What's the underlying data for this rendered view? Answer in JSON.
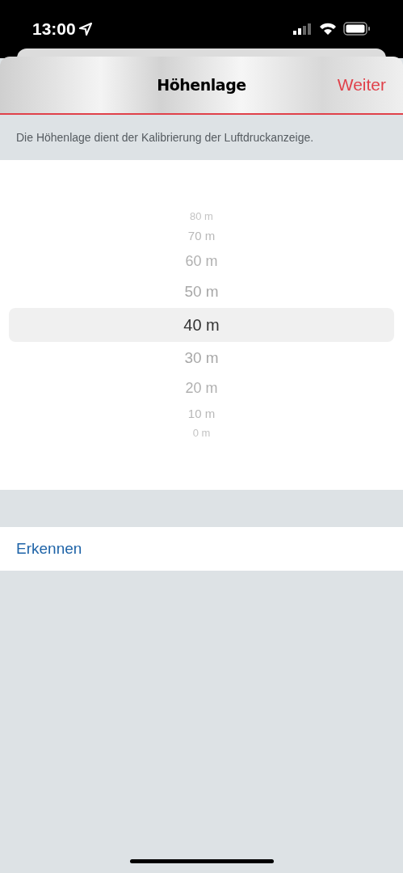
{
  "status_bar": {
    "time": "13:00"
  },
  "nav": {
    "title": "Höhenlage",
    "action": "Weiter"
  },
  "description": "Die Höhenlage dient der Kalibrierung der Luftdruckanzeige.",
  "picker": {
    "items": [
      {
        "label": "80 m",
        "selected": false
      },
      {
        "label": "70 m",
        "selected": false
      },
      {
        "label": "60 m",
        "selected": false
      },
      {
        "label": "50 m",
        "selected": false
      },
      {
        "label": "40 m",
        "selected": true
      },
      {
        "label": "30 m",
        "selected": false
      },
      {
        "label": "20 m",
        "selected": false
      },
      {
        "label": "10 m",
        "selected": false
      },
      {
        "label": "0 m",
        "selected": false
      }
    ]
  },
  "detect_button": "Erkennen"
}
